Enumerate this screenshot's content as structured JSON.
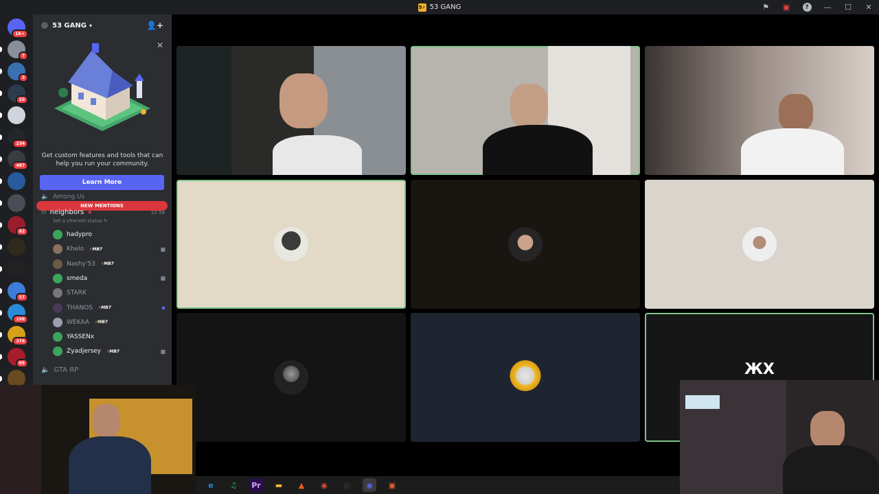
{
  "window": {
    "title": "53 GANG"
  },
  "rail": {
    "servers": [
      {
        "badge": "1K+",
        "color": "#5865f2"
      },
      {
        "badge": "7",
        "color": "#8a8f9c"
      },
      {
        "badge": "3",
        "color": "#3a6fb0"
      },
      {
        "badge": "20",
        "color": "#2d3b4f"
      },
      {
        "badge": "",
        "color": "#d0d4dc"
      },
      {
        "badge": "234",
        "color": "#24262b"
      },
      {
        "badge": "487",
        "color": "#3a3c42"
      },
      {
        "badge": "",
        "color": "#275b9e"
      },
      {
        "badge": "",
        "color": "#4a4d55"
      },
      {
        "badge": "62",
        "color": "#9b1d2b"
      },
      {
        "badge": "",
        "color": "#2f2a1c"
      },
      {
        "badge": "",
        "color": "#222"
      },
      {
        "badge": "57",
        "color": "#3d7dd8"
      },
      {
        "badge": "196",
        "color": "#2a8cd9"
      },
      {
        "badge": "376",
        "color": "#d6a019"
      },
      {
        "badge": "65",
        "color": "#a61c2b"
      },
      {
        "badge": "",
        "color": "#6a4a1f"
      }
    ]
  },
  "sidebar": {
    "server_name": "53 GANG",
    "promo": {
      "text": "Get custom features and tools that can help you run your community.",
      "button": "Learn More"
    },
    "category_top": "Among Us",
    "new_mentions": "NEW MENTIONS",
    "voice_channel": {
      "name": "neighbors",
      "time": "22:56",
      "status": "Set a channel status"
    },
    "members": [
      {
        "name": "hadypro",
        "tag": "",
        "dim": false,
        "icon": "",
        "color": "#3ba55c"
      },
      {
        "name": "Khelo",
        "tag": "MB7",
        "dim": true,
        "icon": "video",
        "color": "#8a7060"
      },
      {
        "name": "Nashy'53",
        "tag": "MB7",
        "dim": true,
        "icon": "",
        "color": "#6b5b4a"
      },
      {
        "name": "smeda",
        "tag": "",
        "dim": false,
        "icon": "video",
        "color": "#3ba55c"
      },
      {
        "name": "STARK",
        "tag": "",
        "dim": true,
        "icon": "",
        "color": "#777"
      },
      {
        "name": "THANOS",
        "tag": "MB7",
        "dim": true,
        "icon": "purple",
        "color": "#4a3a5a"
      },
      {
        "name": "WEKAA",
        "tag": "MB7",
        "dim": true,
        "icon": "",
        "color": "#9aa0b0"
      },
      {
        "name": "YASSENx",
        "tag": "",
        "dim": false,
        "icon": "",
        "color": "#3ba55c"
      },
      {
        "name": "Zyadjersey",
        "tag": "MB7",
        "dim": false,
        "icon": "video",
        "color": "#3ba55c"
      }
    ],
    "category_bottom": "GTA RP"
  },
  "taskbar": {
    "apps": [
      {
        "name": "edge-icon",
        "glyph": "e",
        "color": "#1e8fd6"
      },
      {
        "name": "spotify-icon",
        "glyph": "♫",
        "color": "#1db954"
      },
      {
        "name": "premiere-icon",
        "glyph": "Pr",
        "color": "#2a0d4a"
      },
      {
        "name": "folder-icon",
        "glyph": "▬",
        "color": "#e8b43a"
      },
      {
        "name": "brave-icon",
        "glyph": "▲",
        "color": "#f05a24"
      },
      {
        "name": "chrome-icon",
        "glyph": "◉",
        "color": "#dd4b39"
      },
      {
        "name": "obs-icon",
        "glyph": "◎",
        "color": "#444"
      },
      {
        "name": "discord-icon",
        "glyph": "◉",
        "color": "#5865f2"
      },
      {
        "name": "app-icon",
        "glyph": "▣",
        "color": "#e8632a"
      }
    ]
  }
}
